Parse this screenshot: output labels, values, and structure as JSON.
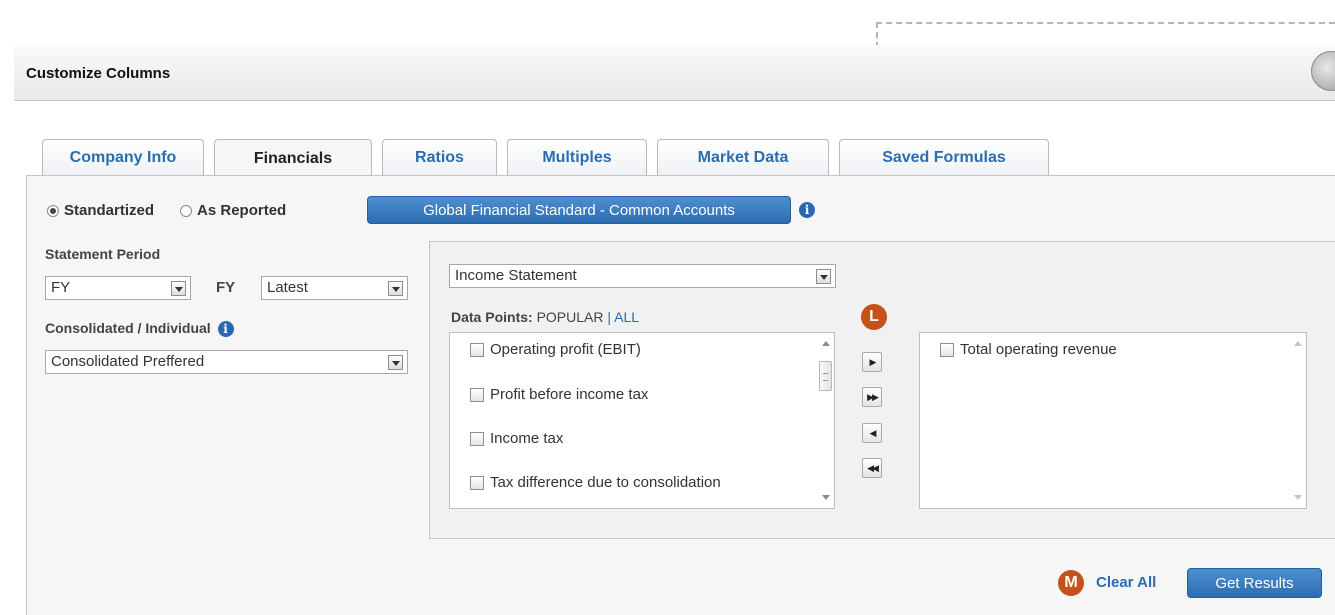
{
  "dialog": {
    "title": "Customize Columns"
  },
  "tabs": [
    {
      "label": "Company Info"
    },
    {
      "label": "Financials"
    },
    {
      "label": "Ratios"
    },
    {
      "label": "Multiples"
    },
    {
      "label": "Market Data"
    },
    {
      "label": "Saved Formulas"
    }
  ],
  "standard": {
    "option_standardized": "Standartized",
    "option_as_reported": "As Reported",
    "standard_button": "Global Financial Standard - Common Accounts",
    "info_glyph": "i"
  },
  "statement_period": {
    "label": "Statement Period",
    "period_value": "FY",
    "fy_label": "FY",
    "fy_value": "Latest"
  },
  "consolidation": {
    "label": "Consolidated / Individual",
    "value": "Consolidated Preffered"
  },
  "statement_select": {
    "value": "Income Statement"
  },
  "data_points": {
    "label": "Data Points:",
    "popular": "POPULAR",
    "separator": "|",
    "all": "ALL",
    "available": [
      {
        "label": "Operating profit (EBIT)"
      },
      {
        "label": "Profit before income tax"
      },
      {
        "label": "Income tax"
      },
      {
        "label": "Tax difference due to consolidation"
      }
    ],
    "selected": [
      {
        "label": "Total operating revenue"
      }
    ]
  },
  "move_buttons": {
    "add": "▶",
    "add_all": "▶▶",
    "remove": "◀",
    "remove_all": "◀◀"
  },
  "markers": {
    "l": "L",
    "m": "M"
  },
  "footer": {
    "clear_all": "Clear All",
    "get_results": "Get Results"
  },
  "colors": {
    "accent": "#2d6db0",
    "marker": "#c4521a",
    "link": "#2a6db1"
  },
  "icons": [
    "close-icon",
    "info-icon",
    "dropdown-arrow-icon",
    "scroll-up-icon",
    "scroll-down-icon"
  ]
}
